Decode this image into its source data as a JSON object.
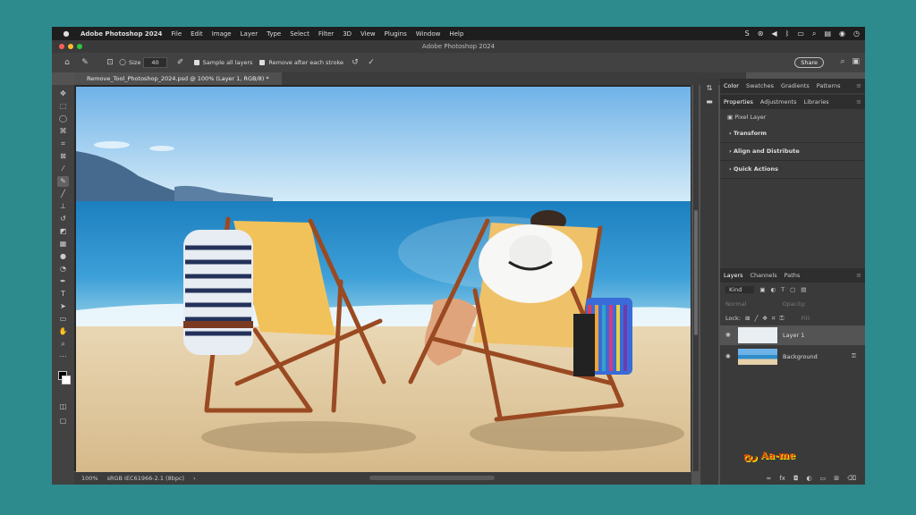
{
  "menubar": {
    "app_name": "Adobe Photoshop 2024",
    "items": [
      "File",
      "Edit",
      "Image",
      "Layer",
      "Type",
      "Select",
      "Filter",
      "3D",
      "View",
      "Plugins",
      "Window",
      "Help"
    ]
  },
  "window": {
    "title": "Adobe Photoshop 2024"
  },
  "options": {
    "size_label": "Size",
    "size_value": "40",
    "sample_all_layers": "Sample all layers",
    "remove_after_stroke": "Remove after each stroke",
    "share": "Share"
  },
  "document": {
    "tab_title": "Remove_Tool_Photoshop_2024.psd @ 100% (Layer 1, RGB/8) *"
  },
  "status": {
    "zoom": "100%",
    "profile": "sRGB IEC61966-2.1 (8bpc)"
  },
  "panels": {
    "top_tabs": [
      "Color",
      "Swatches",
      "Gradients",
      "Patterns"
    ],
    "props_tabs": [
      "Properties",
      "Adjustments",
      "Libraries"
    ],
    "pixel_layer": "Pixel Layer",
    "sections": [
      "Transform",
      "Align and Distribute",
      "Quick Actions"
    ],
    "layer_tabs": [
      "Layers",
      "Channels",
      "Paths"
    ],
    "kind": "Kind",
    "blend": "Normal",
    "opacity": "Opacity:",
    "lock": "Lock:",
    "fill": "Fill:",
    "layers": [
      "Layer 1",
      "Background"
    ]
  },
  "colors": {
    "desktop": "#2e8b8d",
    "app_bg": "#535353",
    "menubar": "#1e1e1e"
  },
  "watermark": "ربح Aa-me"
}
